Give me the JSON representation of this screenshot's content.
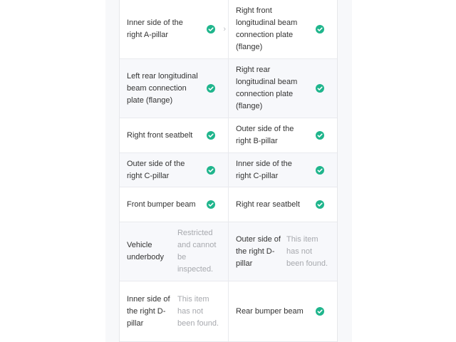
{
  "rows": [
    {
      "left": {
        "label": "Inner side of the right A-pillar",
        "status": "ok"
      },
      "right": {
        "label": "Right front longitudinal beam connection plate (flange)",
        "status": "ok"
      }
    },
    {
      "left": {
        "label": "Left rear longitudinal beam connection plate (flange)",
        "status": "ok"
      },
      "right": {
        "label": "Right rear longitudinal beam connection plate (flange)",
        "status": "ok"
      }
    },
    {
      "left": {
        "label": "Right front seatbelt",
        "status": "ok"
      },
      "right": {
        "label": "Outer side of the right B-pillar",
        "status": "ok"
      }
    },
    {
      "left": {
        "label": "Outer side of the right C-pillar",
        "status": "ok"
      },
      "right": {
        "label": "Inner side of the right C-pillar",
        "status": "ok"
      }
    },
    {
      "left": {
        "label": "Front bumper beam",
        "status": "ok"
      },
      "right": {
        "label": "Right rear seatbelt",
        "status": "ok"
      }
    },
    {
      "left": {
        "label": "Vehicle underbody",
        "note": "Restricted and cannot be inspected."
      },
      "right": {
        "label": "Outer side of the right D-pillar",
        "note": "This item has not been found."
      }
    },
    {
      "left": {
        "label": "Inner side of the right D-pillar",
        "note": "This item has not been found."
      },
      "right": {
        "label": "Rear bumper beam",
        "status": "ok"
      }
    }
  ],
  "colors": {
    "check": "#1fb58c",
    "note": "#a7a9ae",
    "chevron": "#bdbfc4"
  },
  "icons": {
    "status_ok": "check-circle-icon",
    "expand": "chevron-right-icon"
  }
}
